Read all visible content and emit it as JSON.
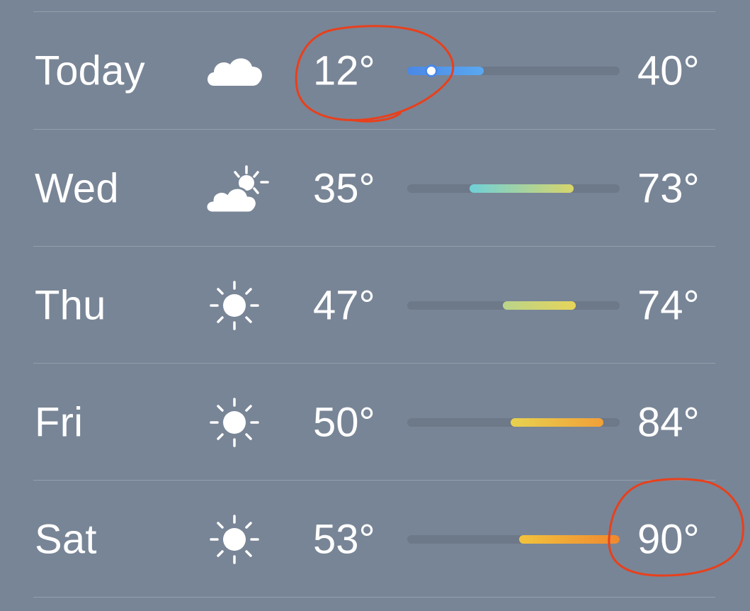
{
  "colors": {
    "background": "#788596",
    "text": "#ffffff",
    "track": "#6d7888",
    "annotation": "#e8401c"
  },
  "temperature_scale": {
    "min": 12,
    "max": 90
  },
  "days": [
    {
      "day": "Today",
      "icon": "cloud-icon",
      "low": "12°",
      "high": "40°",
      "low_value": 12,
      "high_value": 40,
      "current_value": 14,
      "gradient": [
        "#4a88e6",
        "#5aa8f0"
      ]
    },
    {
      "day": "Wed",
      "icon": "partly-sunny-icon",
      "low": "35°",
      "high": "73°",
      "low_value": 35,
      "high_value": 73,
      "gradient": [
        "#6fd0d8",
        "#d8d56a"
      ]
    },
    {
      "day": "Thu",
      "icon": "sun-icon",
      "low": "47°",
      "high": "74°",
      "low_value": 47,
      "high_value": 74,
      "gradient": [
        "#b9d48a",
        "#e7d45a"
      ]
    },
    {
      "day": "Fri",
      "icon": "sun-icon",
      "low": "50°",
      "high": "84°",
      "low_value": 50,
      "high_value": 84,
      "gradient": [
        "#e8d24f",
        "#f0a038"
      ]
    },
    {
      "day": "Sat",
      "icon": "sun-icon",
      "low": "53°",
      "high": "90°",
      "low_value": 53,
      "high_value": 90,
      "gradient": [
        "#f2c33d",
        "#ef8830"
      ]
    }
  ]
}
